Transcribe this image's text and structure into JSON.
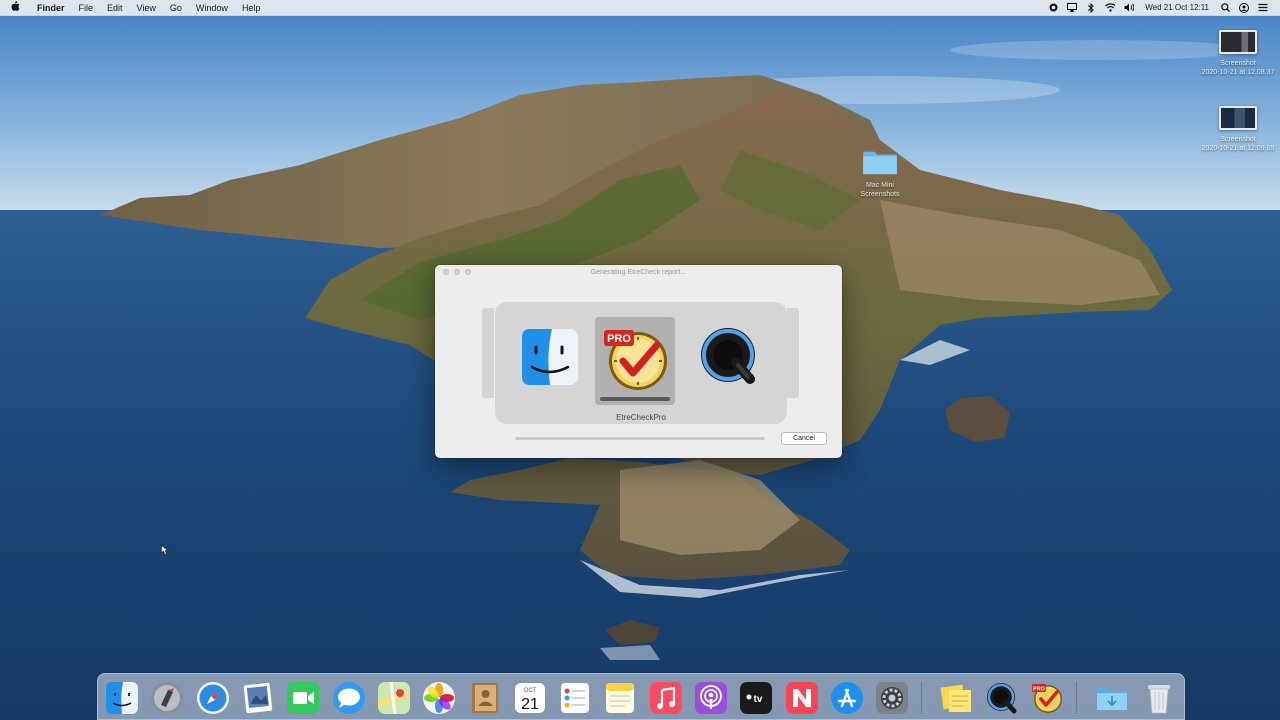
{
  "menubar": {
    "apple": "",
    "app_name": "Finder",
    "items": [
      "File",
      "Edit",
      "View",
      "Go",
      "Window",
      "Help"
    ],
    "clock": "Wed 21 Oct  12:11",
    "status_icons": [
      "screen-record-icon",
      "airplay-icon",
      "bluetooth-icon",
      "wifi-icon",
      "volume-icon",
      "search-icon",
      "user-icon",
      "control-center-icon"
    ]
  },
  "desktop_icons": [
    {
      "name": "desktop-icon-screenshot-1",
      "label": "Screenshot\n2020-10-21 at 12.08.37",
      "kind": "screenshot"
    },
    {
      "name": "desktop-icon-screenshot-2",
      "label": "Screenshot\n2020-10-21 at 12.09.05",
      "kind": "screenshot"
    },
    {
      "name": "desktop-icon-folder",
      "label": "Mac Mini\nScreenshots",
      "kind": "folder"
    }
  ],
  "dialog": {
    "title": "Generating EtreCheck report...",
    "selected_app": "EtreCheckPro",
    "selected_progress": 1.0,
    "overall_progress": 0.0,
    "cancel_label": "Cancel",
    "apps": [
      "finder-icon",
      "etrecheck-pro-icon",
      "quicktime-icon"
    ]
  },
  "dock": {
    "calendar_day": "21",
    "calendar_month": "OCT",
    "items": [
      "finder-icon",
      "launchpad-icon",
      "safari-icon",
      "preview-icon",
      "facetime-icon",
      "messages-icon",
      "maps-icon",
      "photos-icon",
      "contacts-icon",
      "calendar-icon",
      "reminders-icon",
      "notes-icon",
      "music-icon",
      "podcasts-icon",
      "apple-tv-icon",
      "news-icon",
      "app-store-icon",
      "system-preferences-icon",
      "stickies-icon",
      "quicktime-icon",
      "etrecheck-pro-icon",
      "downloads-folder-icon",
      "trash-icon"
    ]
  },
  "colors": {
    "sky": "#5d8fc4",
    "sea": "#1f4a7c",
    "menubar": "#eceef2",
    "dialog_bg": "#ececec"
  }
}
